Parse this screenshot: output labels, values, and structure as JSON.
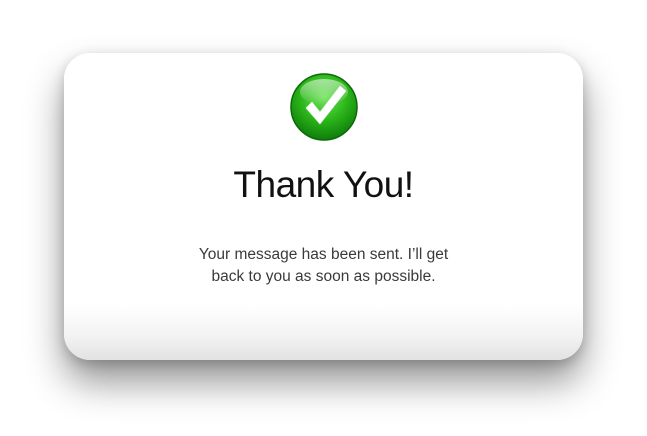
{
  "dialog": {
    "icon": "checkmark-success-icon",
    "title": "Thank You!",
    "message_line1": "Your message has been sent. I’ll get",
    "message_line2": "back to you as soon as possible."
  },
  "colors": {
    "success_green": "#2bb51a",
    "success_green_dark": "#0f7d0a",
    "title_text": "#111111",
    "body_text": "#3a3a3a"
  }
}
